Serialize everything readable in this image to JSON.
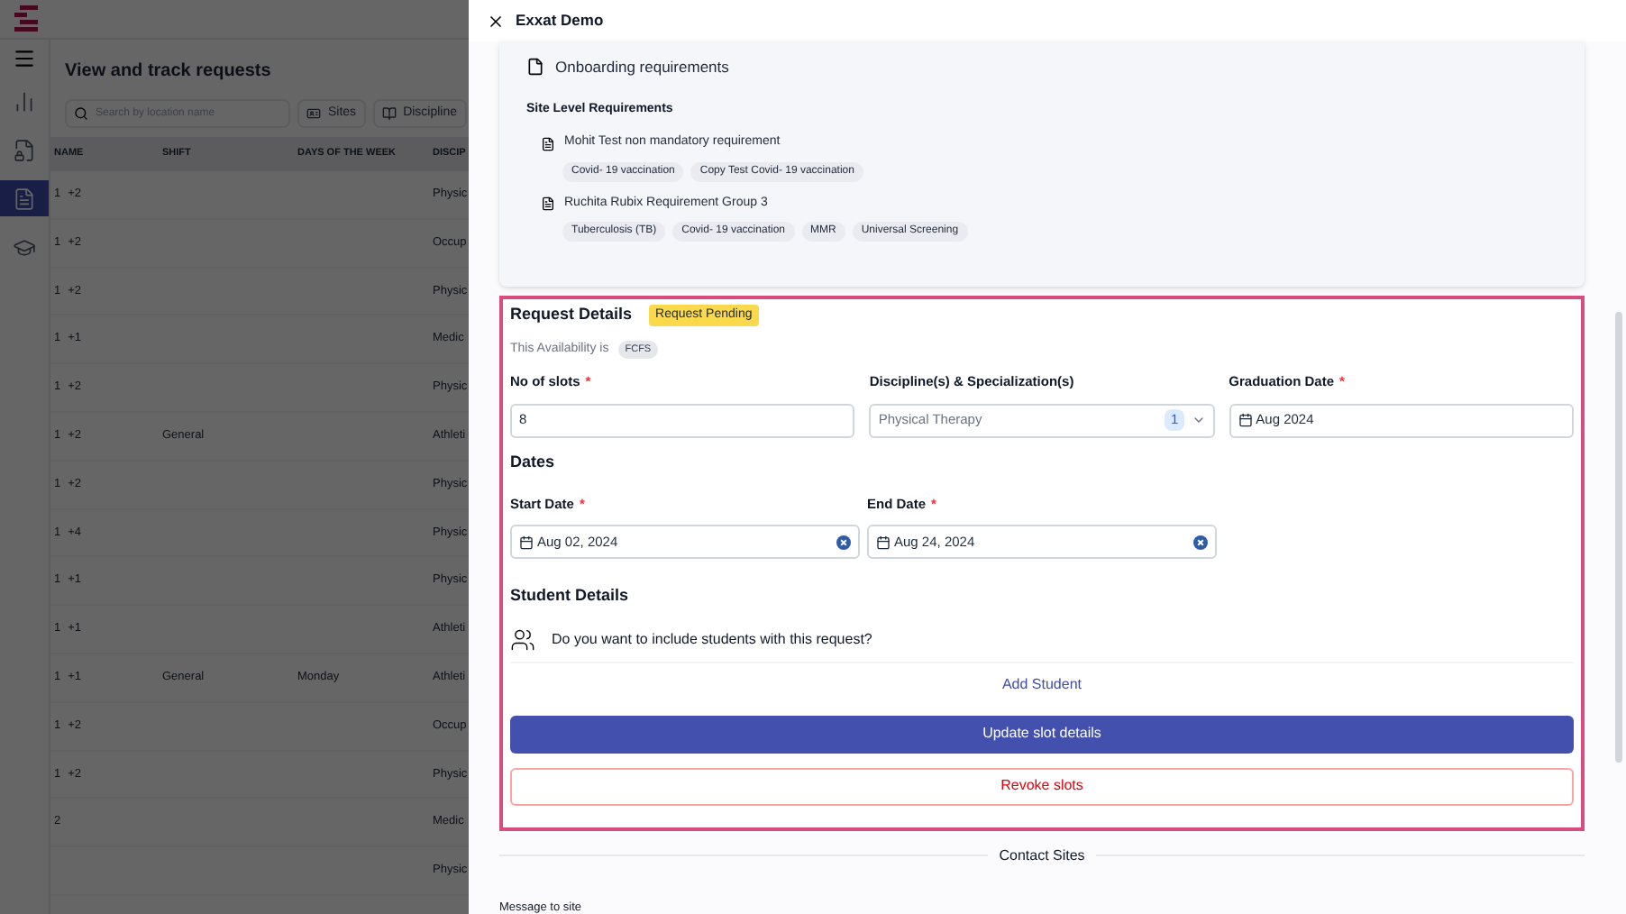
{
  "background": {
    "page_title": "View and track requests",
    "search": {
      "placeholder": "Search by location name"
    },
    "filters": [
      "Sites",
      "Discipline"
    ],
    "table": {
      "columns": [
        "NAME",
        "SHIFT",
        "DAYS OF THE WEEK",
        "DISCIP"
      ],
      "rows": [
        {
          "name": "1",
          "extra": "+2",
          "shift": "",
          "days": "",
          "discipline": "Physic"
        },
        {
          "name": "1",
          "extra": "+2",
          "shift": "",
          "days": "",
          "discipline": "Occup"
        },
        {
          "name": "1",
          "extra": "+2",
          "shift": "",
          "days": "",
          "discipline": "Physic"
        },
        {
          "name": "1",
          "extra": "+1",
          "shift": "",
          "days": "",
          "discipline": "Medic"
        },
        {
          "name": "1",
          "extra": "+2",
          "shift": "",
          "days": "",
          "discipline": "Physic"
        },
        {
          "name": "1",
          "extra": "+2",
          "shift": "General",
          "days": "",
          "discipline": "Athleti"
        },
        {
          "name": "1",
          "extra": "+2",
          "shift": "",
          "days": "",
          "discipline": "Physic"
        },
        {
          "name": "1",
          "extra": "+4",
          "shift": "",
          "days": "",
          "discipline": "Physic"
        },
        {
          "name": "1",
          "extra": "+1",
          "shift": "",
          "days": "",
          "discipline": "Physic"
        },
        {
          "name": "1",
          "extra": "+1",
          "shift": "",
          "days": "",
          "discipline": "Athleti"
        },
        {
          "name": "1",
          "extra": "+1",
          "shift": "General",
          "days": "Monday",
          "discipline": "Athleti"
        },
        {
          "name": "1",
          "extra": "+2",
          "shift": "",
          "days": "",
          "discipline": "Occup"
        },
        {
          "name": "1",
          "extra": "+2",
          "shift": "",
          "days": "",
          "discipline": "Physic"
        },
        {
          "name": "2",
          "extra": "",
          "shift": "",
          "days": "",
          "discipline": "Medic"
        },
        {
          "name": "",
          "extra": "",
          "shift": "",
          "days": "",
          "discipline": "Physic"
        }
      ]
    },
    "nav": [
      {
        "kind": "chart",
        "selected": false
      },
      {
        "kind": "doc",
        "selected": false
      },
      {
        "kind": "request",
        "selected": true
      },
      {
        "kind": "cap",
        "selected": false
      }
    ]
  },
  "drawer": {
    "title": "Exxat Demo",
    "onboarding": {
      "title": "Onboarding requirements",
      "subtitle": "Site Level Requirements",
      "groups": [
        {
          "name": "Mohit Test non mandatory requirement",
          "tags": [
            "Covid- 19 vaccination",
            "Copy Test Covid- 19 vaccination"
          ]
        },
        {
          "name": "Ruchita Rubix Requirement Group 3",
          "tags": [
            "Tuberculosis (TB)",
            "Covid- 19 vaccination",
            "MMR",
            "Universal Screening"
          ]
        }
      ]
    },
    "request": {
      "title": "Request Details",
      "status": "Request Pending",
      "availability_label": "This Availability is",
      "availability": "FCFS",
      "fields": [
        {
          "kind": "text",
          "label": "No of slots",
          "required_mark": "*",
          "value": "8"
        },
        {
          "kind": "select",
          "label": "Discipline(s) & Specialization(s)",
          "value": "Physical Therapy",
          "count": "1"
        },
        {
          "kind": "month",
          "label": "Graduation Date",
          "required_mark": "*",
          "value": "Aug 2024"
        }
      ],
      "dates_title": "Dates",
      "dates": [
        {
          "kind": "date",
          "label": "Start Date",
          "required_mark": "*",
          "value": "Aug 02, 2024"
        },
        {
          "kind": "date",
          "label": "End Date",
          "required_mark": "*",
          "value": "Aug 24, 2024"
        }
      ],
      "students_title": "Student Details",
      "students_question": "Do you want to include students with this request?",
      "add_student": "Add Student",
      "buttons": [
        {
          "kind": "primary",
          "label": "Update slot details"
        },
        {
          "kind": "danger",
          "label": "Revoke slots"
        }
      ]
    },
    "contact_title": "Contact Sites",
    "message_label": "Message to site"
  }
}
